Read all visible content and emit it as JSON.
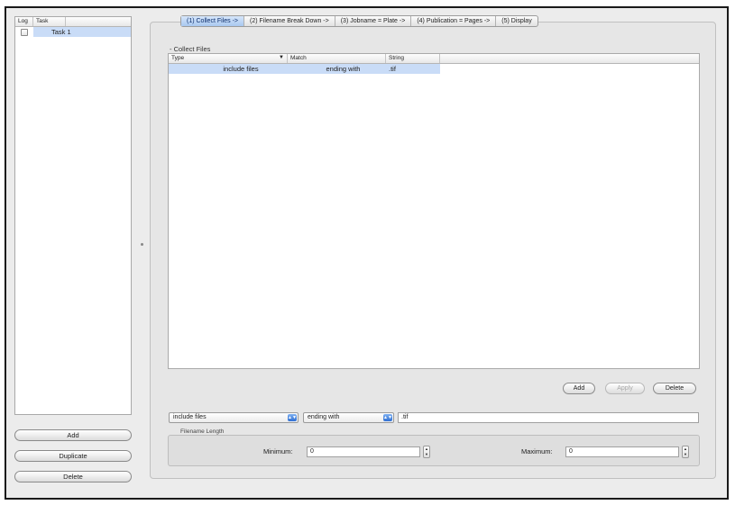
{
  "task_list": {
    "headers": [
      "Log",
      "Task"
    ],
    "rows": [
      {
        "log_checked": false,
        "name": "Task 1"
      }
    ]
  },
  "left_buttons": {
    "add": "Add",
    "duplicate": "Duplicate",
    "delete": "Delete"
  },
  "tabs": [
    {
      "label": "(1) Collect Files ->",
      "active": true
    },
    {
      "label": "(2) Filename Break Down ->",
      "active": false
    },
    {
      "label": "(3) Jobname = Plate ->",
      "active": false
    },
    {
      "label": "(4) Publication = Pages ->",
      "active": false
    },
    {
      "label": "(5) Display",
      "active": false
    }
  ],
  "section_title": "- Collect Files",
  "rules_table": {
    "headers": [
      "Type",
      "Match",
      "String"
    ],
    "sort_icon": "chevron-down-icon",
    "rows": [
      {
        "type": "include files",
        "match": "ending with",
        "string": ".tif"
      }
    ]
  },
  "rule_buttons": {
    "add": "Add",
    "apply": "Apply",
    "delete": "Delete"
  },
  "editor": {
    "type_select": "include files",
    "match_select": "ending with",
    "string_value": ".tif"
  },
  "filename_length": {
    "title": "Filename Length",
    "minimum_label": "Minimum:",
    "minimum_value": "0",
    "maximum_label": "Maximum:",
    "maximum_value": "0"
  },
  "colors": {
    "selection": "#c9dcf7",
    "active_tab": "#a9c8f0",
    "window_bg": "#ececec"
  }
}
